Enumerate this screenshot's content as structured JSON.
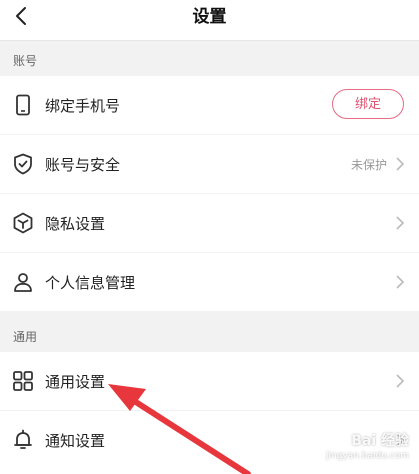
{
  "header": {
    "title": "设置",
    "back_icon": "chevron-left-icon"
  },
  "sections": [
    {
      "label": "账号"
    },
    {
      "label": "通用"
    }
  ],
  "account_items": [
    {
      "label": "绑定手机号",
      "icon": "phone-icon",
      "button_label": "绑定"
    },
    {
      "label": "账号与安全",
      "icon": "shield-check-icon",
      "status": "未保护"
    },
    {
      "label": "隐私设置",
      "icon": "cube-icon"
    },
    {
      "label": "个人信息管理",
      "icon": "person-icon"
    }
  ],
  "general_items": [
    {
      "label": "通用设置",
      "icon": "grid-icon"
    },
    {
      "label": "通知设置",
      "icon": "bell-icon"
    }
  ],
  "colors": {
    "accent": "#e0506f",
    "arrow": "#e8373c"
  },
  "watermark": {
    "text": "Bai 经验",
    "url": "jingyan.baidu.com"
  }
}
